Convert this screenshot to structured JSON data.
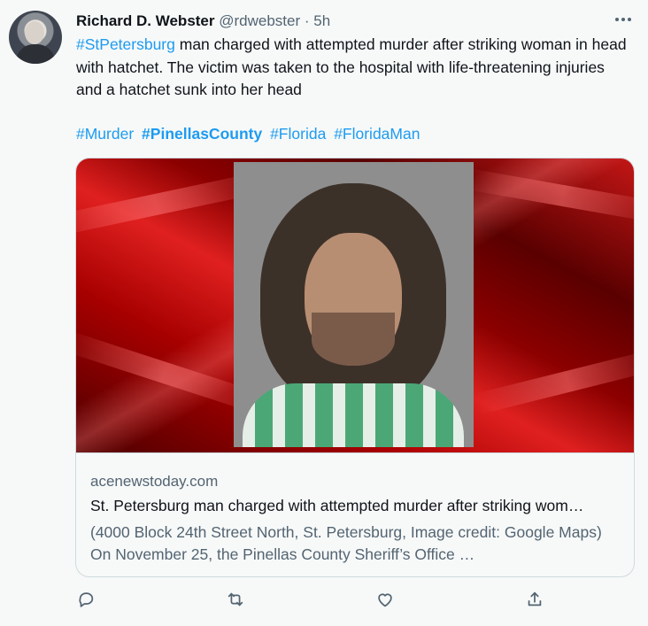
{
  "tweet": {
    "author_name": "Richard D. Webster",
    "author_handle": "@rdwebster",
    "separator": "·",
    "timestamp": "5h",
    "more_icon": "ellipsis-icon",
    "text_hashtag": "#StPetersburg",
    "text_body": " man charged with attempted murder after striking woman in head with hatchet.   The victim was taken to the hospital with life-threatening injuries and a hatchet sunk into her head",
    "hashtags": [
      "#Murder",
      "#PinellasCounty",
      "#Florida",
      "#FloridaMan"
    ]
  },
  "card": {
    "domain": "acenewstoday.com",
    "title": "St. Petersburg man charged with attempted murder after striking wom…",
    "description": "(4000 Block 24th Street North, St. Petersburg, Image credit: Google Maps) On November 25, the Pinellas County Sheriff’s Office …"
  },
  "actions": [
    {
      "icon": "reply-icon"
    },
    {
      "icon": "retweet-icon"
    },
    {
      "icon": "like-icon"
    },
    {
      "icon": "share-icon"
    }
  ],
  "colors": {
    "accent": "#1d9bf0",
    "secondary_text": "#536471",
    "background": "#f7f9f9",
    "card_border": "#cfd9de"
  }
}
